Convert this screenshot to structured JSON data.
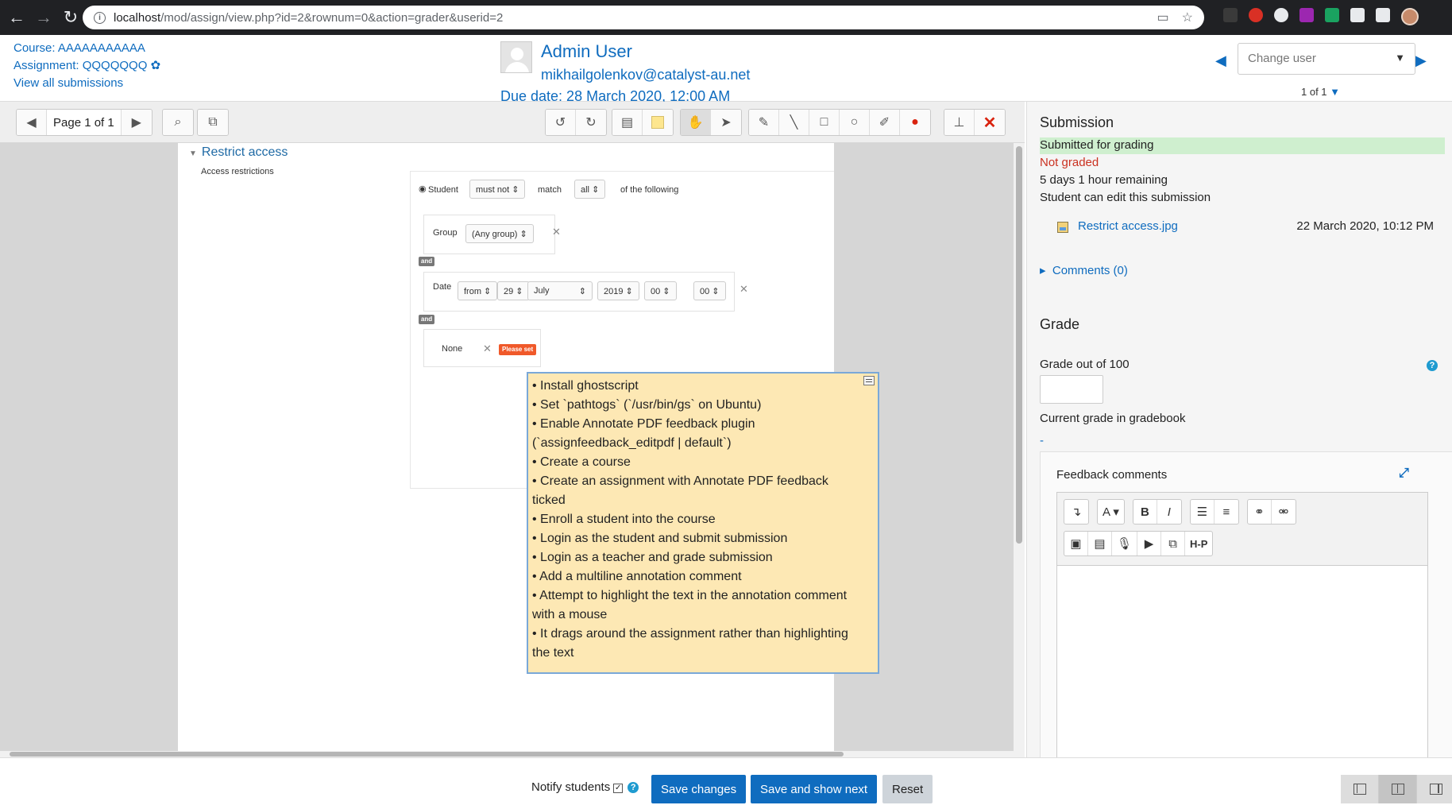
{
  "browser": {
    "url_host": "localhost",
    "url_path": "/mod/assign/view.php?id=2&rownum=0&action=grader&userid=2"
  },
  "header": {
    "course": "Course: AAAAAAAAAAA",
    "assignment": "Assignment: QQQQQQQ",
    "view_all": "View all submissions",
    "user_name": "Admin User",
    "user_email": "mikhailgolenkov@catalyst-au.net",
    "due_date": "Due date: 28 March 2020, 12:00 AM",
    "change_user_placeholder": "Change user",
    "pager_count": "1 of 1"
  },
  "toolbar": {
    "page_label": "Page 1 of 1"
  },
  "pdf": {
    "heading": "Restrict access",
    "subheading": "Access restrictions",
    "student_label": "Student",
    "must_not": "must not",
    "match_label": "match",
    "all": "all",
    "following": "of the following",
    "group_label": "Group",
    "any_group": "(Any group)",
    "and_label": "and",
    "date_label": "Date",
    "date_from": "from",
    "date_day": "29",
    "date_month": "July",
    "date_year": "2019",
    "date_hour": "00",
    "date_min": "00",
    "none_label": "None",
    "please_set": "Please set",
    "please_set_partial": "set"
  },
  "annotation": {
    "lines": [
      "• Install ghostscript",
      "• Set `pathtogs` (`/usr/bin/gs` on Ubuntu)",
      "• Enable Annotate PDF feedback plugin",
      "(`assignfeedback_editpdf | default`)",
      "• Create a course",
      "• Create an assignment with Annotate PDF feedback",
      "ticked",
      "• Enroll a student into the course",
      "• Login as the student and submit submission",
      "• Login as a teacher and grade submission",
      "• Add a multiline annotation comment",
      "• Attempt to highlight the text in the annotation comment",
      "with a mouse",
      "• It drags around the assignment rather than highlighting",
      "the text"
    ]
  },
  "submission": {
    "title": "Submission",
    "status": "Submitted for grading",
    "grading_status": "Not graded",
    "time_remaining": "5 days 1 hour remaining",
    "editable": "Student can edit this submission",
    "file_name": "Restrict access.jpg",
    "file_date": "22 March 2020, 10:12 PM",
    "comments": "Comments (0)"
  },
  "grade": {
    "title": "Grade",
    "grade_out_of": "Grade out of 100",
    "current_grade_label": "Current grade in gradebook",
    "current_grade_value": "-",
    "feedback_label": "Feedback comments",
    "h5p_label": "H-P"
  },
  "footer": {
    "notify_label": "Notify students",
    "save_changes": "Save changes",
    "save_next": "Save and show next",
    "reset": "Reset"
  }
}
